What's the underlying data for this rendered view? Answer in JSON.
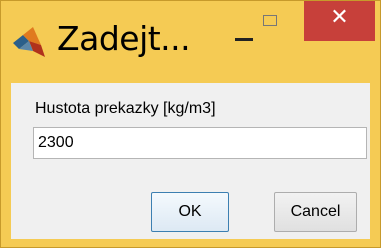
{
  "window": {
    "title": "Zadejt...",
    "icon": "matlab-icon",
    "controls": {
      "minimize": "minimize-icon",
      "maximize": "maximize-icon",
      "close_glyph": "✕"
    }
  },
  "prompt": {
    "label": "Hustota prekazky [kg/m3]",
    "value": "2300"
  },
  "buttons": {
    "ok": "OK",
    "cancel": "Cancel"
  },
  "colors": {
    "titlebar": "#f5cb54",
    "close": "#c7403a"
  }
}
